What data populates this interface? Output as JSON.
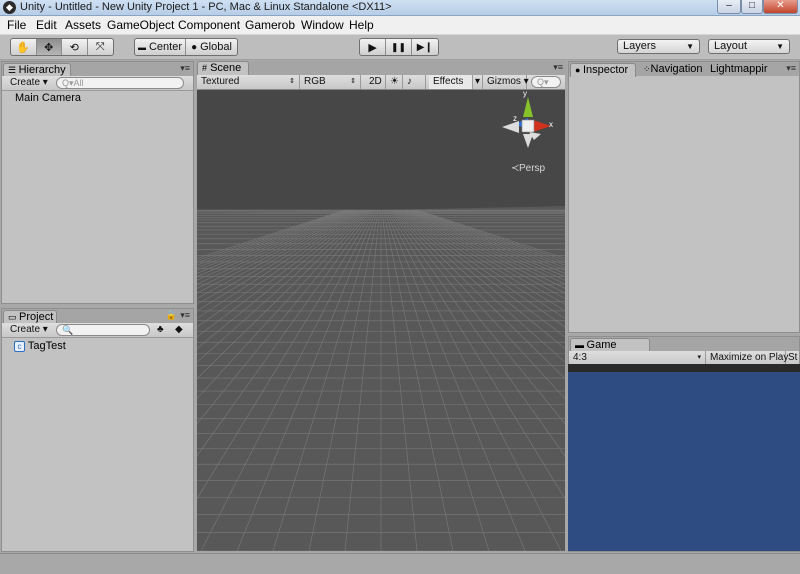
{
  "window": {
    "title": "Unity - Untitled - New Unity Project 1 - PC, Mac & Linux Standalone <DX11>",
    "app_icon": "unity-logo-icon",
    "controls": [
      "minimize",
      "maximize",
      "close"
    ],
    "control_glyphs": {
      "minimize": "–",
      "maximize": "□",
      "close": "✕"
    }
  },
  "menu": [
    "File",
    "Edit",
    "Assets",
    "GameObject",
    "Component",
    "Gamerob",
    "Window",
    "Help"
  ],
  "toolbar": {
    "tools": [
      {
        "name": "hand-tool",
        "glyph": "✋",
        "active": false
      },
      {
        "name": "move-tool",
        "glyph": "✥",
        "active": true
      },
      {
        "name": "rotate-tool",
        "glyph": "⟲",
        "active": false
      },
      {
        "name": "scale-tool",
        "glyph": "⤧",
        "active": false
      }
    ],
    "pivot_label": "Center",
    "space_label": "Global",
    "play_glyph": "▶",
    "pause_glyph": "❚❚",
    "step_glyph": "▶❙",
    "layers_label": "Layers",
    "layout_label": "Layout"
  },
  "hierarchy": {
    "tab_label": "Hierarchy",
    "create_label": "Create",
    "search_placeholder": "Q▾All",
    "items": [
      "Main Camera"
    ]
  },
  "project": {
    "tab_label": "Project",
    "create_label": "Create",
    "items": [
      "TagTest"
    ]
  },
  "scene": {
    "tab_label": "Scene",
    "shading_mode": "Textured",
    "render_mode": "RGB",
    "toggle_2d": "2D",
    "effects_label": "Effects",
    "gizmos_label": "Gizmos",
    "persp_label": "Persp",
    "axis_labels": {
      "x": "x",
      "y": "y",
      "z": "z"
    },
    "colors": {
      "sky": "#474747",
      "ground": "#585858",
      "grid": "#7a7a7a",
      "x_axis": "#d0321e",
      "y_axis": "#86c32b",
      "z_axis": "#2f6fd3"
    }
  },
  "inspector": {
    "tabs": [
      "Inspector",
      "Navigation",
      "Lightmappir"
    ]
  },
  "game": {
    "tab_label": "Game",
    "aspect": "4:3",
    "maximize_label": "Maximize on Play",
    "stats_label": "St",
    "background_color": "#2e4c82"
  }
}
